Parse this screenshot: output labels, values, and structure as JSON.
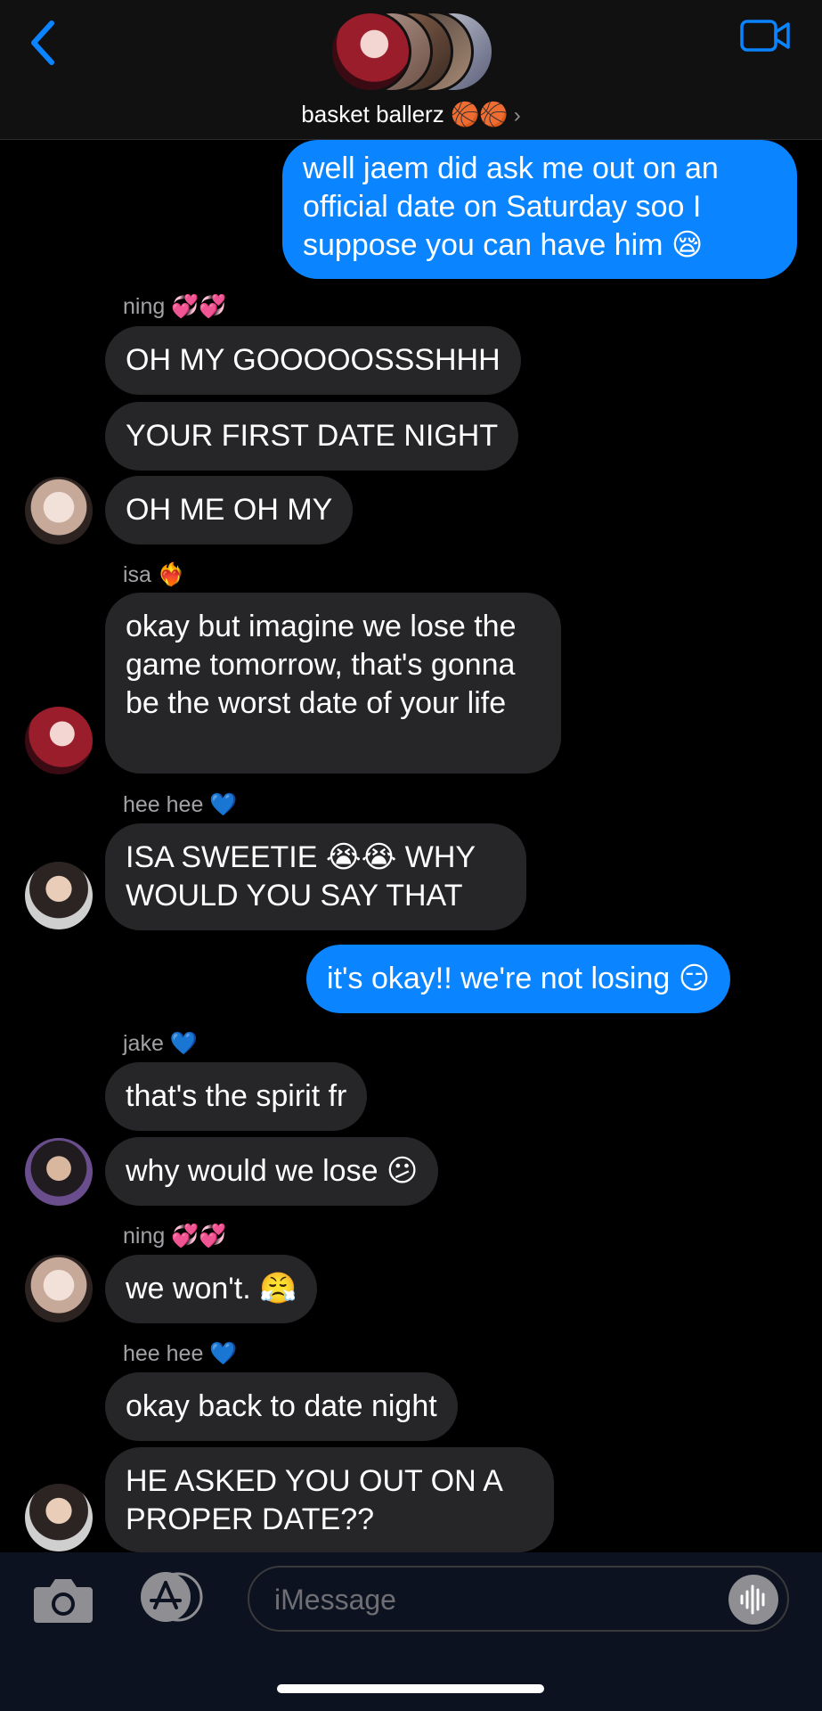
{
  "header": {
    "group_name": "basket ballerz 🏀🏀",
    "chevron": "›",
    "back_icon": "chevron-left-icon",
    "video_icon": "video-camera-icon"
  },
  "messages": [
    {
      "type": "outgoing",
      "text": "well jaem did ask me out on an official date on Saturday soo I suppose you can have him 😪"
    },
    {
      "type": "sender",
      "text": "ning 💞💞"
    },
    {
      "type": "incoming",
      "text": "OH MY GOOOOOSSSHHH"
    },
    {
      "type": "incoming",
      "text": "YOUR FIRST DATE NIGHT"
    },
    {
      "type": "incoming",
      "text": "OH ME OH MY"
    },
    {
      "type": "sender",
      "text": "isa ❤️‍🔥"
    },
    {
      "type": "incoming",
      "text": "okay but imagine we lose the game tomorrow, that's gonna be the worst date of your life"
    },
    {
      "type": "sender",
      "text": "hee hee 💙"
    },
    {
      "type": "incoming",
      "text": "ISA SWEETIE 😭😭 WHY WOULD YOU SAY THAT"
    },
    {
      "type": "outgoing",
      "text": "it's okay!! we're not losing 😏"
    },
    {
      "type": "sender",
      "text": "jake 💙"
    },
    {
      "type": "incoming",
      "text": "that's the spirit fr"
    },
    {
      "type": "incoming",
      "text": "why would we lose 😕"
    },
    {
      "type": "sender",
      "text": "ning 💞💞"
    },
    {
      "type": "incoming",
      "text": "we won't. 😤"
    },
    {
      "type": "sender",
      "text": "hee hee 💙"
    },
    {
      "type": "incoming",
      "text": "okay back to date night"
    },
    {
      "type": "incoming",
      "text": "HE ASKED YOU OUT ON A PROPER DATE??"
    }
  ],
  "composer": {
    "placeholder": "iMessage",
    "camera_icon": "camera-icon",
    "appstore_icon": "app-store-icon",
    "audio_icon": "audio-waveform-icon"
  },
  "colors": {
    "outgoing_bubble": "#0a84ff",
    "incoming_bubble": "#262629",
    "background": "#000000",
    "accent": "#0a84ff"
  }
}
